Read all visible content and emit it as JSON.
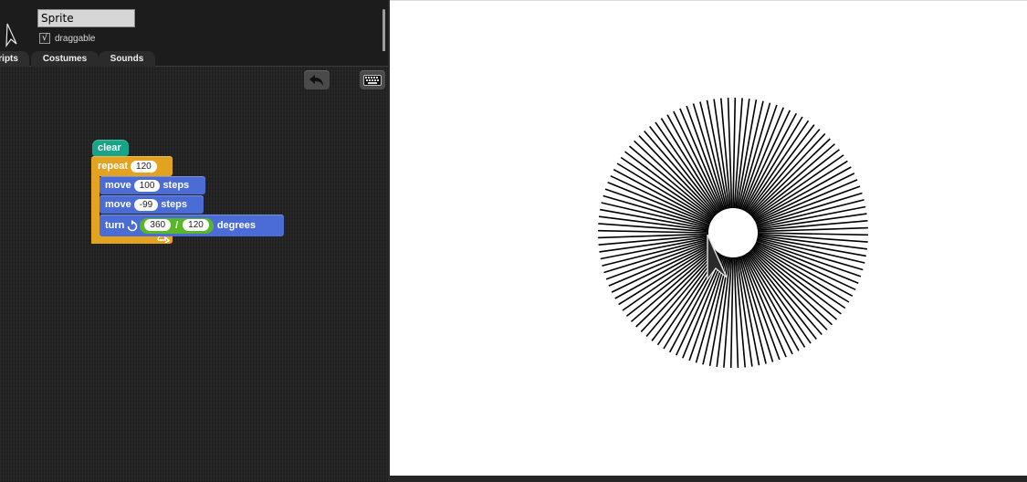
{
  "sprite": {
    "name": "Sprite",
    "draggable_label": "draggable",
    "draggable_checked": true,
    "draggable_mark": "√"
  },
  "tabs": [
    {
      "label": "Scripts"
    },
    {
      "label": "Costumes"
    },
    {
      "label": "Sounds"
    }
  ],
  "toolbar": {
    "undo_icon": "undo-arrow-icon",
    "keyboard_icon": "keyboard-icon"
  },
  "script": {
    "clear_label": "clear",
    "repeat_label": "repeat",
    "repeat_count": "120",
    "move1_label": "move",
    "move1_steps": "100",
    "move1_unit": "steps",
    "move2_label": "move",
    "move2_steps": "-99",
    "move2_unit": "steps",
    "turn_label": "turn",
    "turn_dividend": "360",
    "turn_operator": "/",
    "turn_divisor": "120",
    "turn_unit": "degrees"
  },
  "colors": {
    "pen_block": "#17a589",
    "control_block": "#e3a21f",
    "motion_block": "#4a6cd4",
    "operator_block": "#58b728",
    "stage_bg": "#ffffff",
    "pen_color": "#000000"
  },
  "stage_drawing": {
    "line_count": 120,
    "line_length_steps": 100,
    "turn_degrees_each": 3
  }
}
